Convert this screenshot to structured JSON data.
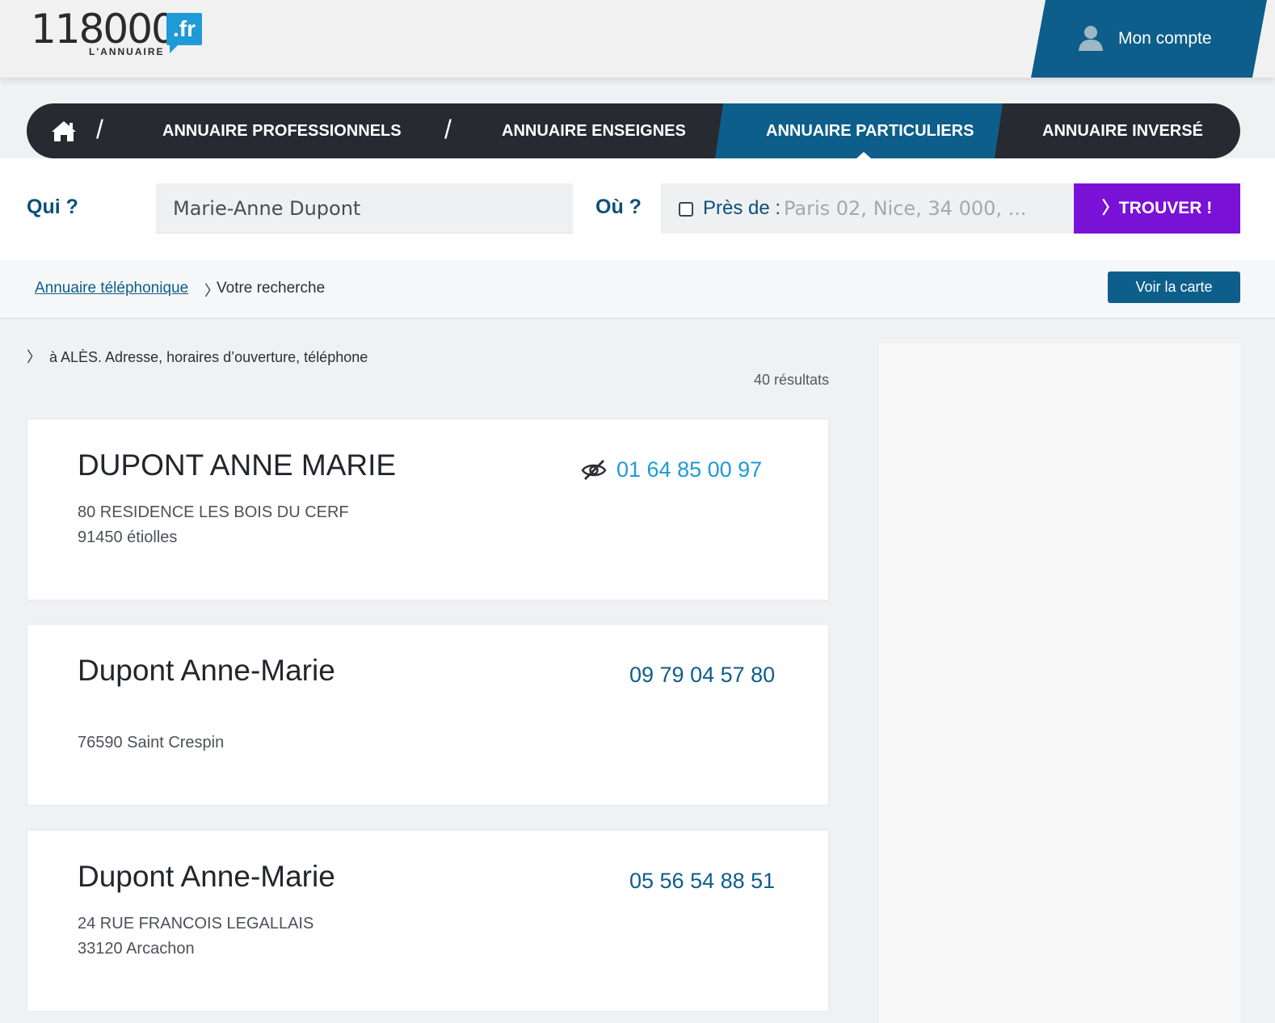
{
  "header": {
    "logo_number": "118000",
    "logo_tld": ".fr",
    "logo_sub": "L'ANNUAIRE",
    "account_label": "Mon compte"
  },
  "nav": {
    "items": [
      {
        "label": "ANNUAIRE PROFESSIONNELS"
      },
      {
        "label": "ANNUAIRE ENSEIGNES"
      },
      {
        "label": "ANNUAIRE PARTICULIERS"
      },
      {
        "label": "ANNUAIRE INVERSÉ"
      }
    ],
    "separator": "/",
    "active_index": 2
  },
  "search": {
    "qui_label": "Qui ?",
    "qui_value": "Marie-Anne Dupont",
    "ou_label": "Où ?",
    "pres_de_label": "Près de :",
    "ou_placeholder": "Paris 02, Nice, 34 000, ...",
    "near_checked": false,
    "find_label": "〉TROUVER !"
  },
  "breadcrumb": {
    "link": "Annuaire téléphonique",
    "separator": "〉",
    "current": "Votre recherche",
    "map_button": "Voir la carte"
  },
  "results": {
    "subtitle_sep": "〉",
    "subtitle": "à ALÈS. Adresse, horaires d’ouverture, téléphone",
    "count": "40 résultats",
    "items": [
      {
        "name": "DUPONT ANNE MARIE",
        "address_line1": "80 RESIDENCE LES BOIS DU CERF",
        "address_line2": "91450 étiolles",
        "phone": "01 64 85 00 97",
        "phone_hidden": true
      },
      {
        "name": "Dupont Anne-Marie",
        "address_line1": "",
        "address_line2": "76590 Saint Crespin",
        "phone": "09 79 04 57 80",
        "phone_hidden": false
      },
      {
        "name": "Dupont Anne-Marie",
        "address_line1": "24 RUE FRANCOIS LEGALLAIS",
        "address_line2": "33120 Arcachon",
        "phone": "05 56 54 88 51",
        "phone_hidden": false
      }
    ]
  },
  "icons": {
    "home": "home-icon",
    "account": "user-icon",
    "hidden_number": "eye-slash-icon"
  },
  "colors": {
    "brand_blue": "#0d5e8a",
    "nav_dark": "#272a30",
    "find_purple": "#7a11d6",
    "logo_blue": "#1e9ad6"
  }
}
